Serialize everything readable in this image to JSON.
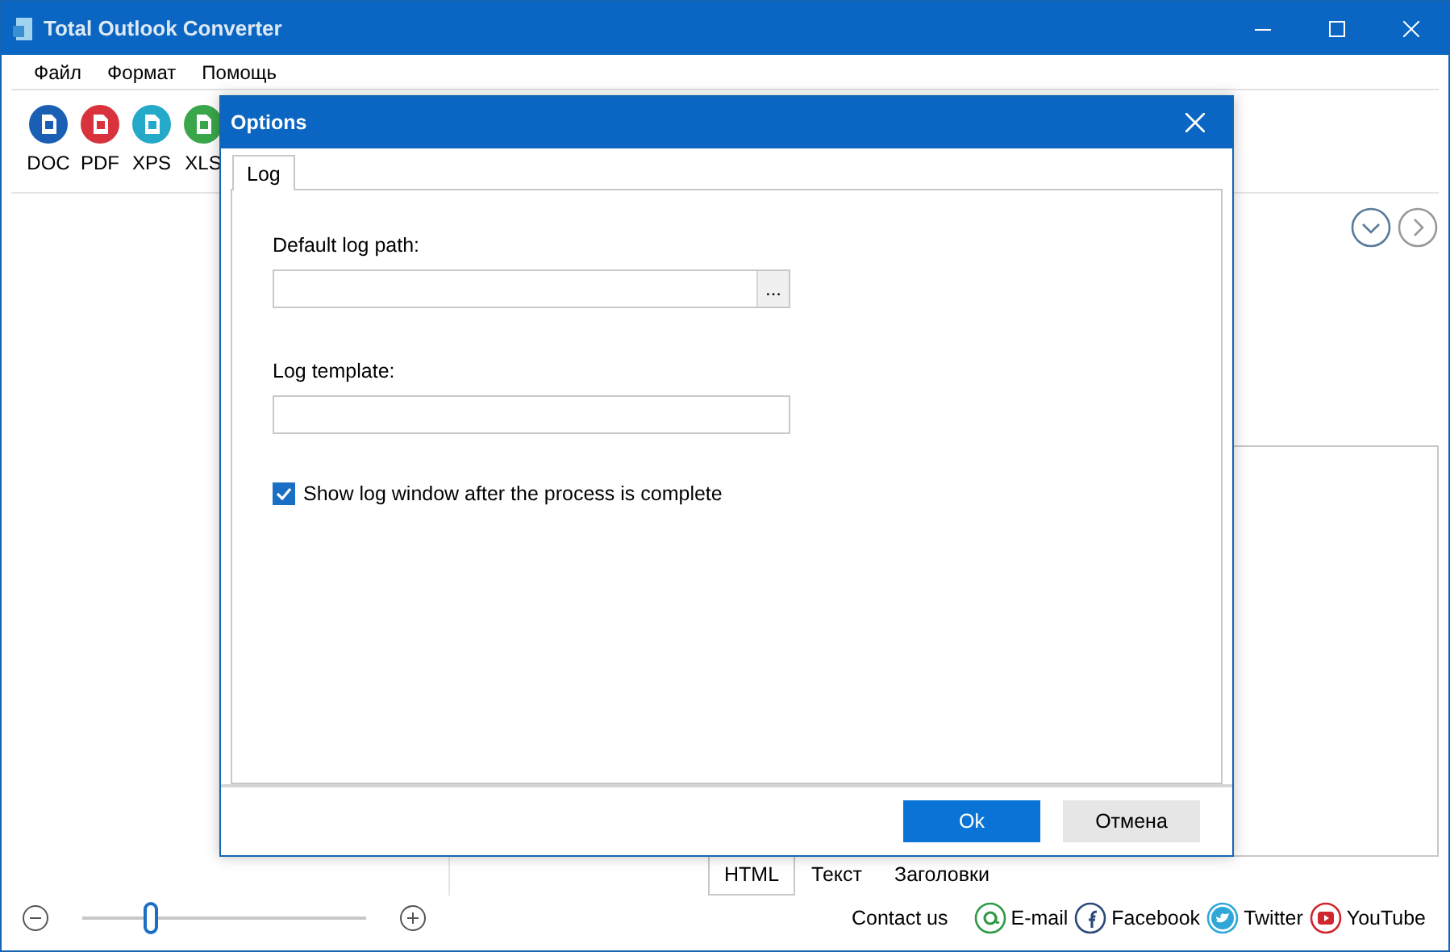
{
  "window": {
    "title": "Total Outlook Converter"
  },
  "menu": [
    "Файл",
    "Формат",
    "Помощь"
  ],
  "formats": [
    {
      "label": "DOC",
      "color": "#1a5fb4"
    },
    {
      "label": "PDF",
      "color": "#d8323c"
    },
    {
      "label": "XPS",
      "color": "#25a9c8"
    },
    {
      "label": "XLS",
      "color": "#3aa64a"
    }
  ],
  "view_tabs": [
    {
      "label": "HTML",
      "selected": true
    },
    {
      "label": "Текст",
      "selected": false
    },
    {
      "label": "Заголовки",
      "selected": false
    }
  ],
  "zoom": {
    "level": 0.24
  },
  "footer": {
    "contact": "Contact us",
    "links": [
      {
        "label": "E-mail",
        "color": "#2e9a47",
        "kind": "email"
      },
      {
        "label": "Facebook",
        "color": "#2b4a7a",
        "kind": "facebook"
      },
      {
        "label": "Twitter",
        "color": "#2fa8d8",
        "kind": "twitter"
      },
      {
        "label": "YouTube",
        "color": "#d0262d",
        "kind": "youtube"
      }
    ]
  },
  "dialog": {
    "title": "Options",
    "tabs": [
      {
        "label": "Log",
        "selected": true
      }
    ],
    "fields": [
      {
        "label": "Default log path:",
        "browse_button": "..."
      },
      {
        "label": "Log template:"
      }
    ],
    "checkbox": {
      "label": "Show log window after the process is complete",
      "checked": true
    },
    "buttons": [
      {
        "label": "Ok",
        "primary": true
      },
      {
        "label": "Отмена",
        "primary": false
      }
    ]
  }
}
